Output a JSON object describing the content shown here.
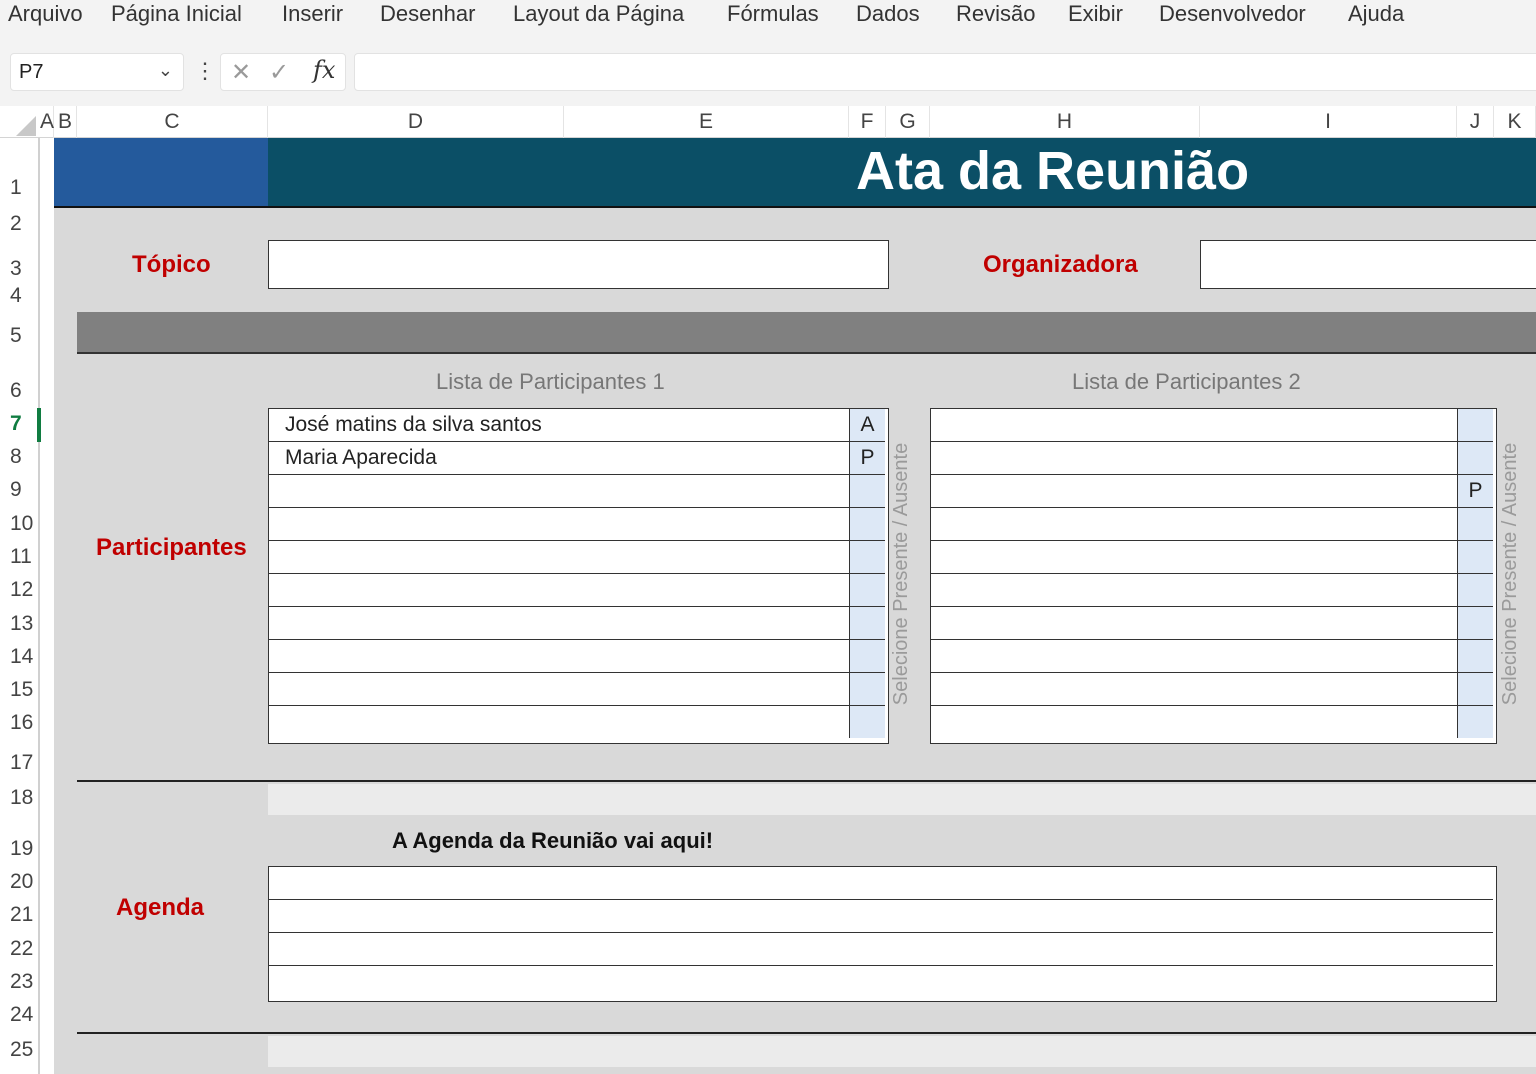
{
  "menu": [
    "Arquivo",
    "Página Inicial",
    "Inserir",
    "Desenhar",
    "Layout da Página",
    "Fórmulas",
    "Dados",
    "Revisão",
    "Exibir",
    "Desenvolvedor",
    "Ajuda"
  ],
  "formula_bar": {
    "name_box": "P7",
    "fx_label": "fx",
    "cancel_glyph": "✕",
    "confirm_glyph": "✓",
    "formula": ""
  },
  "columns": [
    "A",
    "B",
    "C",
    "D",
    "E",
    "F",
    "G",
    "H",
    "I",
    "J",
    "K"
  ],
  "rows": [
    "1",
    "2",
    "3",
    "4",
    "5",
    "6",
    "7",
    "8",
    "9",
    "10",
    "11",
    "12",
    "13",
    "14",
    "15",
    "16",
    "17",
    "18",
    "19",
    "20",
    "21",
    "22",
    "23",
    "24",
    "25"
  ],
  "active_row": "7",
  "sheet": {
    "title": "Ata da Reunião",
    "topic_label": "Tópico",
    "topic_value": "",
    "organizer_label": "Organizadora",
    "organizer_value": "",
    "participants_label": "Participantes",
    "list1": {
      "title": "Lista de Participantes 1",
      "vertical_label": "Selecione Presente / Ausente",
      "rows": [
        {
          "name": "José matins da silva santos",
          "status": "A"
        },
        {
          "name": "Maria Aparecida",
          "status": "P"
        },
        {
          "name": "",
          "status": ""
        },
        {
          "name": "",
          "status": ""
        },
        {
          "name": "",
          "status": ""
        },
        {
          "name": "",
          "status": ""
        },
        {
          "name": "",
          "status": ""
        },
        {
          "name": "",
          "status": ""
        },
        {
          "name": "",
          "status": ""
        },
        {
          "name": "",
          "status": ""
        }
      ]
    },
    "list2": {
      "title": "Lista de Participantes 2",
      "vertical_label": "Selecione Presente / Ausente",
      "rows": [
        {
          "name": "",
          "status": ""
        },
        {
          "name": "",
          "status": ""
        },
        {
          "name": "",
          "status": "P"
        },
        {
          "name": "",
          "status": ""
        },
        {
          "name": "",
          "status": ""
        },
        {
          "name": "",
          "status": ""
        },
        {
          "name": "",
          "status": ""
        },
        {
          "name": "",
          "status": ""
        },
        {
          "name": "",
          "status": ""
        },
        {
          "name": "",
          "status": ""
        }
      ]
    },
    "agenda_label": "Agenda",
    "agenda_title": "A Agenda da Reunião vai aqui!",
    "agenda_rows": [
      "",
      "",
      "",
      ""
    ]
  },
  "colors": {
    "accent_green": "#107c41",
    "title_blue": "#245a9c",
    "title_teal": "#0b4f66",
    "label_red": "#c00000",
    "status_fill": "#dde8f6"
  }
}
